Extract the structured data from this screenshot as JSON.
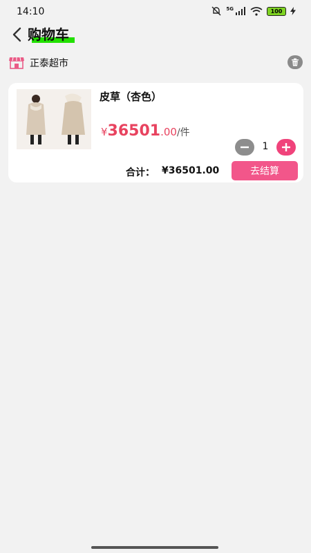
{
  "status_bar": {
    "time": "14:10",
    "battery": "100",
    "network": "5G"
  },
  "header": {
    "title": "购物车",
    "back_icon": "chevron-left-icon"
  },
  "store": {
    "name": "正泰超市",
    "icon": "shop-icon",
    "delete_icon": "trash-icon"
  },
  "cart": {
    "items": [
      {
        "name": "皮草（杏色）",
        "currency": "¥",
        "price_int": "36501",
        "price_dec": ".00",
        "unit": "/件",
        "quantity": "1"
      }
    ],
    "total_label": "合计：",
    "total_value": "¥36501.00",
    "checkout_label": "去结算"
  },
  "colors": {
    "accent": "#f2568a",
    "price": "#e8435f",
    "background": "#f2f2f2",
    "highlight": "#22e000"
  }
}
